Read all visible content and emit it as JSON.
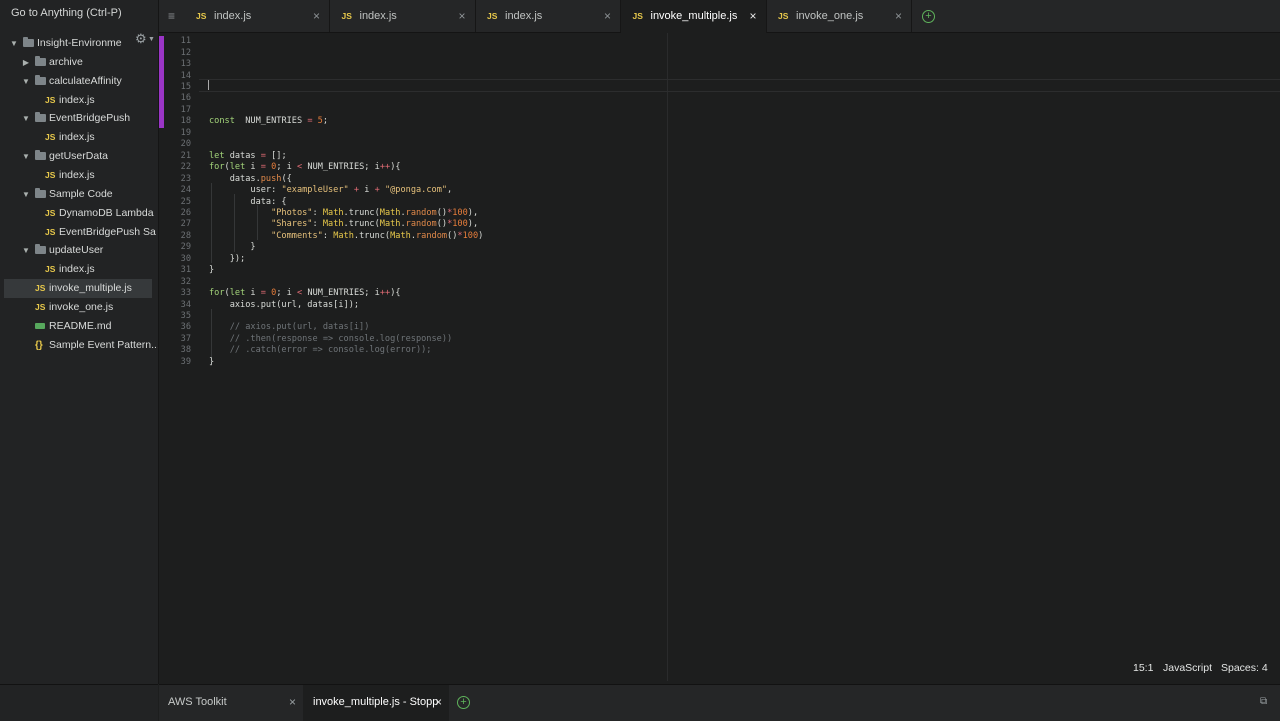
{
  "sidebar": {
    "goto_label": "Go to Anything (Ctrl-P)",
    "tree": [
      {
        "label": "Insight-Environme",
        "type": "folder",
        "expanded": true,
        "depth": 0
      },
      {
        "label": "archive",
        "type": "folder",
        "expanded": false,
        "depth": 1
      },
      {
        "label": "calculateAffinity",
        "type": "folder",
        "expanded": true,
        "depth": 1
      },
      {
        "label": "index.js",
        "type": "js",
        "depth": 2
      },
      {
        "label": "EventBridgePush",
        "type": "folder",
        "expanded": true,
        "depth": 1
      },
      {
        "label": "index.js",
        "type": "js",
        "depth": 2
      },
      {
        "label": "getUserData",
        "type": "folder",
        "expanded": true,
        "depth": 1
      },
      {
        "label": "index.js",
        "type": "js",
        "depth": 2
      },
      {
        "label": "Sample Code",
        "type": "folder",
        "expanded": true,
        "depth": 1
      },
      {
        "label": "DynamoDB Lambda",
        "type": "js",
        "depth": 2
      },
      {
        "label": "EventBridgePush Sa",
        "type": "js",
        "depth": 2
      },
      {
        "label": "updateUser",
        "type": "folder",
        "expanded": true,
        "depth": 1
      },
      {
        "label": "index.js",
        "type": "js",
        "depth": 2
      },
      {
        "label": "invoke_multiple.js",
        "type": "js",
        "depth": 1,
        "selected": true
      },
      {
        "label": "invoke_one.js",
        "type": "js",
        "depth": 1
      },
      {
        "label": "README.md",
        "type": "md",
        "depth": 1
      },
      {
        "label": "Sample Event Pattern...",
        "type": "json",
        "depth": 1
      }
    ]
  },
  "icons": {
    "js_badge": "JS",
    "json_badge": "{}",
    "close": "×",
    "plus": "+",
    "expanded_arrow": "▼",
    "collapsed_arrow": "▶",
    "gear": "⚙",
    "menu": "≡"
  },
  "tabs": [
    {
      "label": "index.js",
      "active": false
    },
    {
      "label": "index.js",
      "active": false
    },
    {
      "label": "index.js",
      "active": false
    },
    {
      "label": "invoke_multiple.js",
      "active": true
    },
    {
      "label": "invoke_one.js",
      "active": false
    }
  ],
  "editor": {
    "lines": [
      {
        "n": "11",
        "code": []
      },
      {
        "n": "12",
        "code": []
      },
      {
        "n": "13",
        "code": []
      },
      {
        "n": "14",
        "code": []
      },
      {
        "n": "15",
        "code": []
      },
      {
        "n": "16",
        "code": []
      },
      {
        "n": "17",
        "code": []
      },
      {
        "n": "18",
        "code": [
          [
            "kw",
            "const"
          ],
          [
            "",
            "  NUM_ENTRIES "
          ],
          [
            "op",
            "="
          ],
          [
            "",
            ""
          ],
          [
            "num",
            " 5"
          ],
          [
            "",
            ";"
          ]
        ]
      },
      {
        "n": "19",
        "code": []
      },
      {
        "n": "20",
        "code": []
      },
      {
        "n": "21",
        "code": [
          [
            "kw",
            "let"
          ],
          [
            "",
            " datas "
          ],
          [
            "op",
            "="
          ],
          [
            "",
            " [];"
          ]
        ]
      },
      {
        "n": "22",
        "code": [
          [
            "kw",
            "for"
          ],
          [
            "",
            "("
          ],
          [
            "kw",
            "let"
          ],
          [
            "",
            " i "
          ],
          [
            "op",
            "="
          ],
          [
            "num",
            " 0"
          ],
          [
            "",
            "; i "
          ],
          [
            "op",
            "<"
          ],
          [
            "",
            " NUM_ENTRIES; i"
          ],
          [
            "op",
            "++"
          ],
          [
            "",
            "){"
          ]
        ]
      },
      {
        "n": "23",
        "code": [
          [
            "",
            "    datas."
          ],
          [
            "fn",
            "push"
          ],
          [
            "",
            "({"
          ]
        ]
      },
      {
        "n": "24",
        "code": [
          [
            "",
            "        user: "
          ],
          [
            "st",
            "\"exampleUser\""
          ],
          [
            "op",
            " +"
          ],
          [
            "",
            " i "
          ],
          [
            "op",
            "+"
          ],
          [
            "st",
            " \"@ponga.com\""
          ],
          [
            "",
            ","
          ]
        ]
      },
      {
        "n": "25",
        "code": [
          [
            "",
            "        data: {"
          ]
        ]
      },
      {
        "n": "26",
        "code": [
          [
            "st",
            "            \"Photos\""
          ],
          [
            "",
            ": "
          ],
          [
            "obj",
            "Math"
          ],
          [
            "",
            ".trunc("
          ],
          [
            "obj",
            "Math"
          ],
          [
            "",
            "."
          ],
          [
            "fn",
            "random"
          ],
          [
            "",
            "()"
          ],
          [
            "op",
            "*"
          ],
          [
            "num",
            "100"
          ],
          [
            "",
            "),"
          ]
        ]
      },
      {
        "n": "27",
        "code": [
          [
            "st",
            "            \"Shares\""
          ],
          [
            "",
            ": "
          ],
          [
            "obj",
            "Math"
          ],
          [
            "",
            ".trunc("
          ],
          [
            "obj",
            "Math"
          ],
          [
            "",
            "."
          ],
          [
            "fn",
            "random"
          ],
          [
            "",
            "()"
          ],
          [
            "op",
            "*"
          ],
          [
            "num",
            "100"
          ],
          [
            "",
            "),"
          ]
        ]
      },
      {
        "n": "28",
        "code": [
          [
            "st",
            "            \"Comments\""
          ],
          [
            "",
            ": "
          ],
          [
            "obj",
            "Math"
          ],
          [
            "",
            ".trunc("
          ],
          [
            "obj",
            "Math"
          ],
          [
            "",
            "."
          ],
          [
            "fn",
            "random"
          ],
          [
            "",
            "()"
          ],
          [
            "op",
            "*"
          ],
          [
            "num",
            "100"
          ],
          [
            "",
            ")"
          ]
        ]
      },
      {
        "n": "29",
        "code": [
          [
            "",
            "        }"
          ]
        ]
      },
      {
        "n": "30",
        "code": [
          [
            "",
            "    });"
          ]
        ]
      },
      {
        "n": "31",
        "code": [
          [
            "",
            "}"
          ]
        ]
      },
      {
        "n": "32",
        "code": []
      },
      {
        "n": "33",
        "code": [
          [
            "kw",
            "for"
          ],
          [
            "",
            "("
          ],
          [
            "kw",
            "let"
          ],
          [
            "",
            " i "
          ],
          [
            "op",
            "="
          ],
          [
            "num",
            " 0"
          ],
          [
            "",
            "; i "
          ],
          [
            "op",
            "<"
          ],
          [
            "",
            " NUM_ENTRIES; i"
          ],
          [
            "op",
            "++"
          ],
          [
            "",
            "){"
          ]
        ]
      },
      {
        "n": "34",
        "code": [
          [
            "",
            "    axios.put(url, datas[i]);"
          ]
        ]
      },
      {
        "n": "35",
        "code": []
      },
      {
        "n": "36",
        "code": [
          [
            "cm",
            "    // axios.put(url, datas[i])"
          ]
        ]
      },
      {
        "n": "37",
        "code": [
          [
            "cm",
            "    // .then(response => console.log(response))"
          ]
        ]
      },
      {
        "n": "38",
        "code": [
          [
            "cm",
            "    // .catch(error => console.log(error));"
          ]
        ]
      },
      {
        "n": "39",
        "code": [
          [
            "",
            "}"
          ]
        ]
      }
    ]
  },
  "status": {
    "position": "15:1",
    "language": "JavaScript",
    "indent": "Spaces: 4"
  },
  "bottom_panel": {
    "tabs": [
      {
        "label": "AWS Toolkit",
        "active": false
      },
      {
        "label": "invoke_multiple.js - Stopp",
        "active": true
      }
    ]
  },
  "colors": {
    "accent_modified": "#9a35c6",
    "js_badge": "#e8c94b",
    "add_button": "#5fb35b"
  }
}
